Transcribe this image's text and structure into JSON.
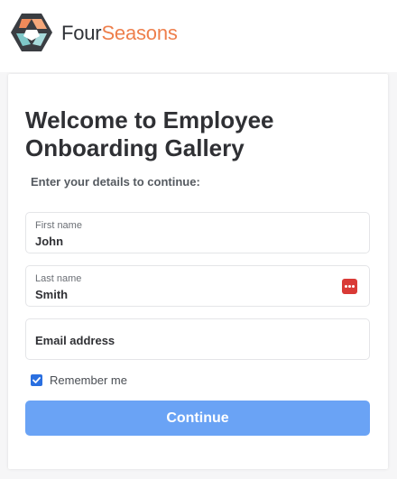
{
  "brand": {
    "name_part1": "Four",
    "name_part2": "Seasons",
    "accent": "#ee7f4c"
  },
  "form": {
    "title": "Welcome to Employee Onboarding Gallery",
    "subtitle": "Enter your details to continue:",
    "first_name": {
      "label": "First name",
      "value": "John"
    },
    "last_name": {
      "label": "Last name",
      "value": "Smith",
      "autofill_icon": "password-manager-icon"
    },
    "email": {
      "placeholder": "Email address",
      "value": ""
    },
    "remember": {
      "label": "Remember me",
      "checked": true
    },
    "submit_label": "Continue",
    "submit_color": "#6aa3f5"
  }
}
